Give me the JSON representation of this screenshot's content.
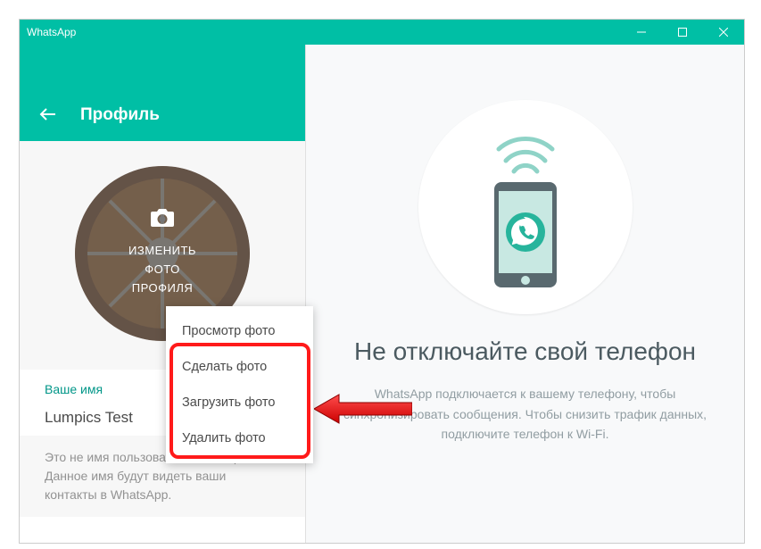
{
  "window": {
    "title": "WhatsApp"
  },
  "sidebar": {
    "header_title": "Профиль",
    "avatar_overlay_line1": "ИЗМЕНИТЬ",
    "avatar_overlay_line2": "ФОТО",
    "avatar_overlay_line3": "ПРОФИЛЯ",
    "name_label": "Ваше имя",
    "name_value": "Lumpics Test",
    "hint": "Это не имя пользователя или пароль. Данное имя будут видеть ваши контакты в WhatsApp."
  },
  "context_menu": {
    "items": [
      "Просмотр фото",
      "Сделать фото",
      "Загрузить фото",
      "Удалить фото"
    ]
  },
  "main": {
    "title": "Не отключайте свой телефон",
    "desc": "WhatsApp подключается к вашему телефону, чтобы синхронизировать сообщения. Чтобы снизить трафик данных, подключите телефон к Wi-Fi."
  }
}
